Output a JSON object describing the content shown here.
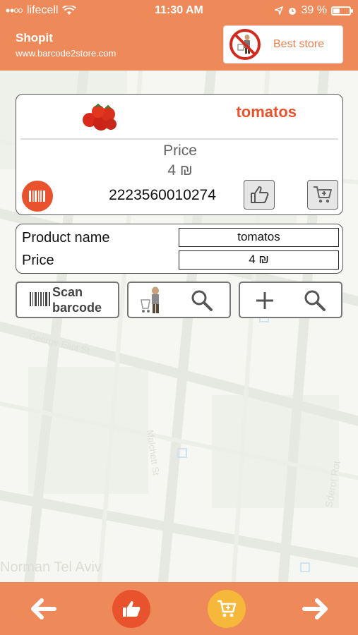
{
  "status_bar": {
    "carrier": "lifecell",
    "time": "11:30 AM",
    "battery_text": "39 %",
    "battery_level": 0.39
  },
  "header": {
    "title": "Shopit",
    "url": "www.barcode2store.com",
    "best_store_label": "Best store"
  },
  "product_card": {
    "name": "tomatos",
    "price_label": "Price",
    "price_value": "4 ₪",
    "barcode": "2223560010274"
  },
  "details": {
    "name_label": "Product name",
    "name_value": "tomatos",
    "price_label": "Price",
    "price_value": "4 ₪"
  },
  "actions": {
    "scan_line1": "Scan",
    "scan_line2": "barcode"
  },
  "map": {
    "labels": [
      "George Eliot St",
      "Malchett St",
      "Norman Tel Aviv",
      "Sderot Rot"
    ]
  },
  "colors": {
    "brand_orange": "#ee8a5a",
    "accent_red": "#e8532e",
    "accent_yellow": "#f5b83a"
  },
  "icons": {
    "back": "arrow-left-icon",
    "like": "thumbs-up-icon",
    "cart": "cart-icon",
    "forward": "arrow-right-icon"
  }
}
